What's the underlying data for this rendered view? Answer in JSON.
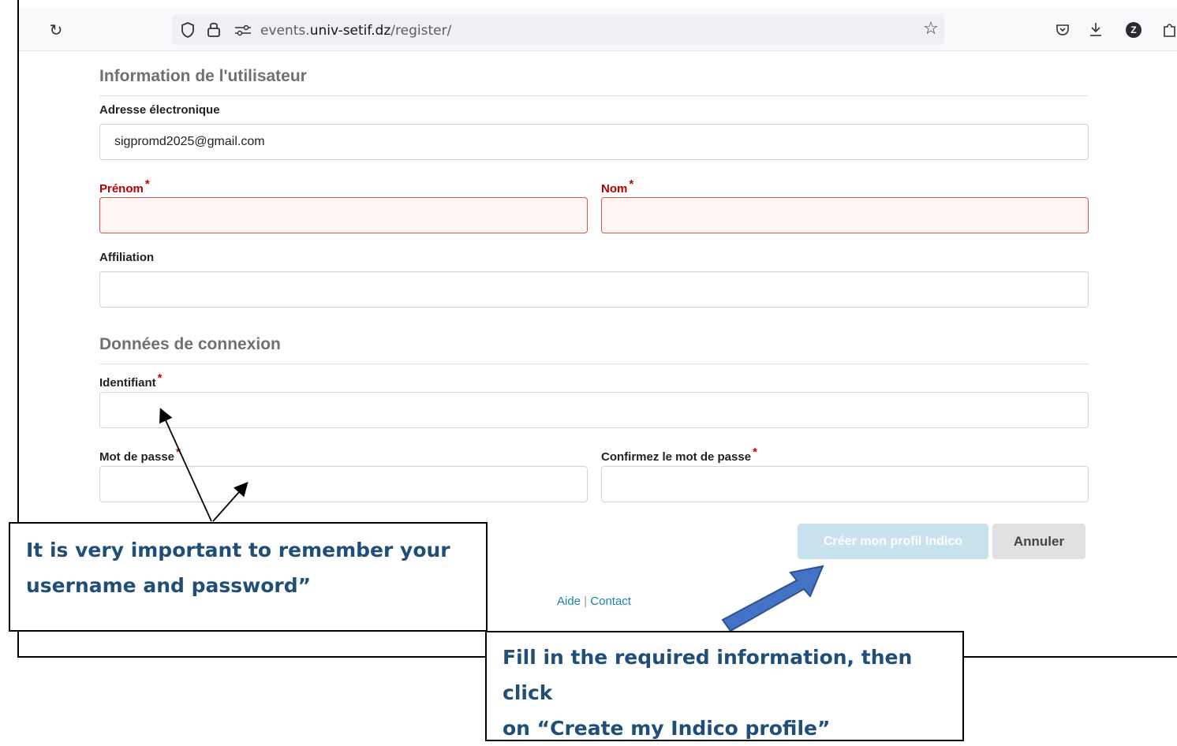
{
  "browser": {
    "url_prefix": "events.",
    "url_domain": "univ-setif.dz",
    "url_path": "/register/",
    "reload_icon": "reload-icon",
    "avatar_letter": "Z"
  },
  "form": {
    "section_user": "Information de l'utilisateur",
    "email_label": "Adresse électronique",
    "email_value": "sigpromd2025@gmail.com",
    "firstname_label": "Prénom",
    "lastname_label": "Nom",
    "affiliation_label": "Affiliation",
    "section_login": "Données de connexion",
    "username_label": "Identifiant",
    "password_label": "Mot de passe",
    "confirm_label": "Confirmez le mot de passe",
    "required_mark": "*",
    "submit_label": "Créer mon profil Indico",
    "cancel_label": "Annuler"
  },
  "footer": {
    "help": "Aide",
    "separator": "|",
    "contact": "Contact"
  },
  "annotations": {
    "left_line1": "It is very important to remember your",
    "left_line2": "username and password”",
    "right_line1": "Fill in the required information, then click",
    "right_line2": "on “Create my Indico profile”"
  },
  "colors": {
    "error_red": "#b30000",
    "callout_text": "#1f4e79",
    "arrow_blue": "#4472c4",
    "link": "#1786b3"
  }
}
